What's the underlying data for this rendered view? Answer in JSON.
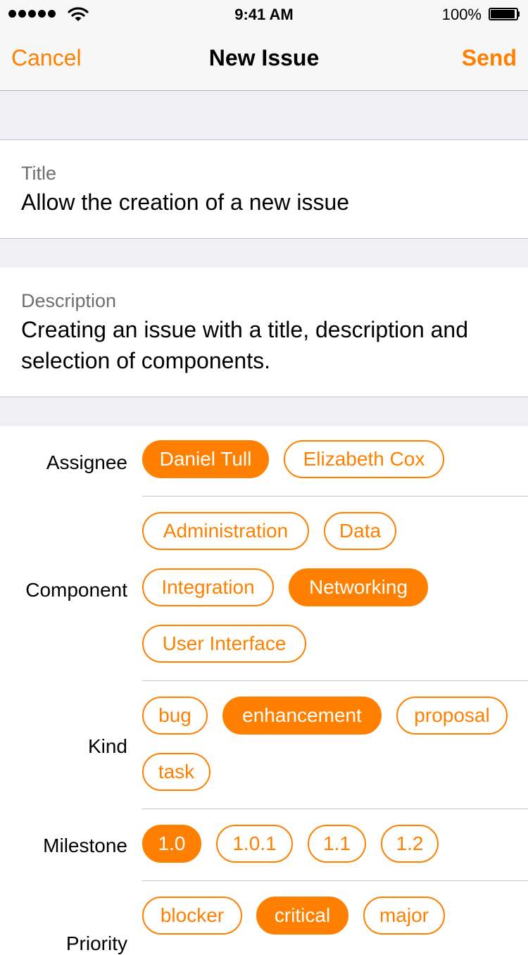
{
  "status_bar": {
    "time": "9:41 AM",
    "battery": "100%"
  },
  "nav": {
    "cancel": "Cancel",
    "title": "New Issue",
    "send": "Send"
  },
  "form": {
    "title_label": "Title",
    "title_value": "Allow the creation of a new issue",
    "description_label": "Description",
    "description_value": "Creating an issue with a title, description and selection of components."
  },
  "rows": {
    "assignee": {
      "label": "Assignee",
      "options": [
        {
          "text": "Daniel Tull",
          "selected": true
        },
        {
          "text": "Elizabeth Cox",
          "selected": false
        }
      ]
    },
    "component": {
      "label": "Component",
      "options": [
        {
          "text": "Administration",
          "selected": false
        },
        {
          "text": "Data",
          "selected": false
        },
        {
          "text": "Integration",
          "selected": false
        },
        {
          "text": "Networking",
          "selected": true
        },
        {
          "text": "User Interface",
          "selected": false
        }
      ]
    },
    "kind": {
      "label": "Kind",
      "options": [
        {
          "text": "bug",
          "selected": false
        },
        {
          "text": "enhancement",
          "selected": true
        },
        {
          "text": "proposal",
          "selected": false
        },
        {
          "text": "task",
          "selected": false
        }
      ]
    },
    "milestone": {
      "label": "Milestone",
      "options": [
        {
          "text": "1.0",
          "selected": true
        },
        {
          "text": "1.0.1",
          "selected": false
        },
        {
          "text": "1.1",
          "selected": false
        },
        {
          "text": "1.2",
          "selected": false
        }
      ]
    },
    "priority": {
      "label": "Priority",
      "options": [
        {
          "text": "blocker",
          "selected": false
        },
        {
          "text": "critical",
          "selected": true
        },
        {
          "text": "major",
          "selected": false
        }
      ]
    }
  },
  "colors": {
    "accent": "#ff8000",
    "group_background": "#efeff4",
    "separator": "#c8c7cc"
  }
}
